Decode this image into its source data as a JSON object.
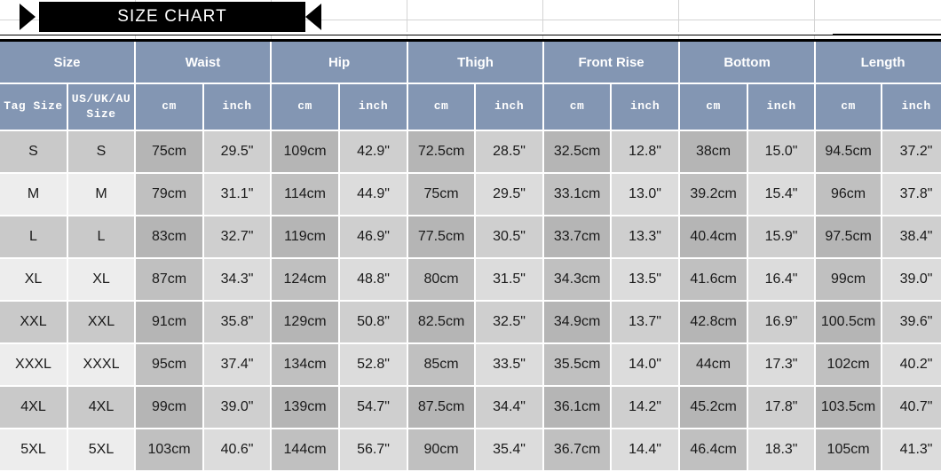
{
  "banner": {
    "title": "SIZE CHART",
    "left_arrow_icon": "chevron-right-icon",
    "right_arrow_icon": "chevron-left-icon"
  },
  "table": {
    "groups": [
      {
        "label": "Size",
        "span": 2
      },
      {
        "label": "Waist",
        "span": 2
      },
      {
        "label": "Hip",
        "span": 2
      },
      {
        "label": "Thigh",
        "span": 2
      },
      {
        "label": "Front Rise",
        "span": 2
      },
      {
        "label": "Bottom",
        "span": 2
      },
      {
        "label": "Length",
        "span": 2
      }
    ],
    "subheaders": [
      "Tag Size",
      "US/UK/AU Size",
      "cm",
      "inch",
      "cm",
      "inch",
      "cm",
      "inch",
      "cm",
      "inch",
      "cm",
      "inch",
      "cm",
      "inch"
    ],
    "rows": [
      {
        "tag_size": "S",
        "us_size": "S",
        "waist_cm": "75cm",
        "waist_inch": "29.5\"",
        "hip_cm": "109cm",
        "hip_inch": "42.9\"",
        "thigh_cm": "72.5cm",
        "thigh_inch": "28.5\"",
        "front_rise_cm": "32.5cm",
        "front_rise_inch": "12.8\"",
        "bottom_cm": "38cm",
        "bottom_inch": "15.0\"",
        "length_cm": "94.5cm",
        "length_inch": "37.2\""
      },
      {
        "tag_size": "M",
        "us_size": "M",
        "waist_cm": "79cm",
        "waist_inch": "31.1\"",
        "hip_cm": "114cm",
        "hip_inch": "44.9\"",
        "thigh_cm": "75cm",
        "thigh_inch": "29.5\"",
        "front_rise_cm": "33.1cm",
        "front_rise_inch": "13.0\"",
        "bottom_cm": "39.2cm",
        "bottom_inch": "15.4\"",
        "length_cm": "96cm",
        "length_inch": "37.8\""
      },
      {
        "tag_size": "L",
        "us_size": "L",
        "waist_cm": "83cm",
        "waist_inch": "32.7\"",
        "hip_cm": "119cm",
        "hip_inch": "46.9\"",
        "thigh_cm": "77.5cm",
        "thigh_inch": "30.5\"",
        "front_rise_cm": "33.7cm",
        "front_rise_inch": "13.3\"",
        "bottom_cm": "40.4cm",
        "bottom_inch": "15.9\"",
        "length_cm": "97.5cm",
        "length_inch": "38.4\""
      },
      {
        "tag_size": "XL",
        "us_size": "XL",
        "waist_cm": "87cm",
        "waist_inch": "34.3\"",
        "hip_cm": "124cm",
        "hip_inch": "48.8\"",
        "thigh_cm": "80cm",
        "thigh_inch": "31.5\"",
        "front_rise_cm": "34.3cm",
        "front_rise_inch": "13.5\"",
        "bottom_cm": "41.6cm",
        "bottom_inch": "16.4\"",
        "length_cm": "99cm",
        "length_inch": "39.0\""
      },
      {
        "tag_size": "XXL",
        "us_size": "XXL",
        "waist_cm": "91cm",
        "waist_inch": "35.8\"",
        "hip_cm": "129cm",
        "hip_inch": "50.8\"",
        "thigh_cm": "82.5cm",
        "thigh_inch": "32.5\"",
        "front_rise_cm": "34.9cm",
        "front_rise_inch": "13.7\"",
        "bottom_cm": "42.8cm",
        "bottom_inch": "16.9\"",
        "length_cm": "100.5cm",
        "length_inch": "39.6\""
      },
      {
        "tag_size": "XXXL",
        "us_size": "XXXL",
        "waist_cm": "95cm",
        "waist_inch": "37.4\"",
        "hip_cm": "134cm",
        "hip_inch": "52.8\"",
        "thigh_cm": "85cm",
        "thigh_inch": "33.5\"",
        "front_rise_cm": "35.5cm",
        "front_rise_inch": "14.0\"",
        "bottom_cm": "44cm",
        "bottom_inch": "17.3\"",
        "length_cm": "102cm",
        "length_inch": "40.2\""
      },
      {
        "tag_size": "4XL",
        "us_size": "4XL",
        "waist_cm": "99cm",
        "waist_inch": "39.0\"",
        "hip_cm": "139cm",
        "hip_inch": "54.7\"",
        "thigh_cm": "87.5cm",
        "thigh_inch": "34.4\"",
        "front_rise_cm": "36.1cm",
        "front_rise_inch": "14.2\"",
        "bottom_cm": "45.2cm",
        "bottom_inch": "17.8\"",
        "length_cm": "103.5cm",
        "length_inch": "40.7\""
      },
      {
        "tag_size": "5XL",
        "us_size": "5XL",
        "waist_cm": "103cm",
        "waist_inch": "40.6\"",
        "hip_cm": "144cm",
        "hip_inch": "56.7\"",
        "thigh_cm": "90cm",
        "thigh_inch": "35.4\"",
        "front_rise_cm": "36.7cm",
        "front_rise_inch": "14.4\"",
        "bottom_cm": "46.4cm",
        "bottom_inch": "18.3\"",
        "length_cm": "105cm",
        "length_inch": "41.3\""
      }
    ]
  },
  "colors": {
    "header_blue": "#8396b3",
    "banner_black": "#000000",
    "row_odd_name": "#c9c9c9",
    "row_even_name": "#ededed",
    "metric_odd": "#b5b5b5",
    "metric_even": "#c0c0c0",
    "imperial_odd": "#cfcfcf",
    "imperial_even": "#dcdcdc"
  }
}
